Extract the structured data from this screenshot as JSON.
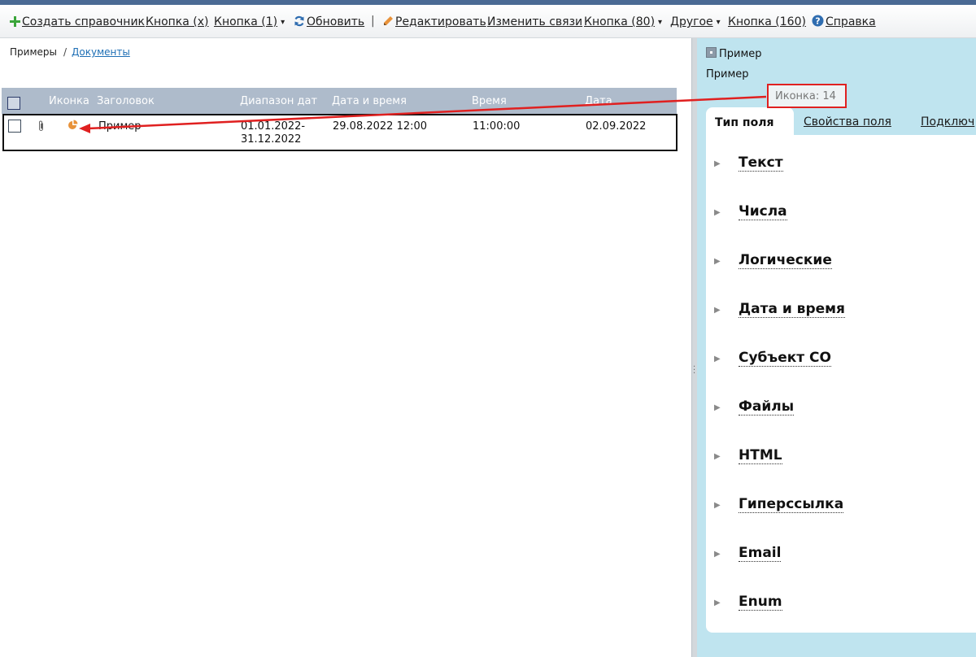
{
  "toolbar": {
    "create_catalog": "Создать справочник",
    "button_x": "Кнопка (x)",
    "button_1": "Кнопка (1)",
    "refresh": "Обновить",
    "separator": "|",
    "edit": "Редактировать",
    "change_links": "Изменить связи",
    "button_80": "Кнопка (80)",
    "other": "Другое",
    "button_160": "Кнопка (160)",
    "help": "Справка",
    "dropdown_glyph": "▾"
  },
  "breadcrumb": {
    "root": "Примеры",
    "separator": "/",
    "current": "Документы"
  },
  "table": {
    "columns": [
      "Иконка",
      "Заголовок",
      "Диапазон дат",
      "Дата и время",
      "Время",
      "Дата"
    ],
    "rows": [
      {
        "title": "Пример",
        "date_range_start": "01.01.2022-",
        "date_range_end": "31.12.2022",
        "datetime": "29.08.2022 12:00",
        "time": "11:00:00",
        "date": "02.09.2022"
      }
    ]
  },
  "detail": {
    "title": "Пример",
    "subtitle": "Пример",
    "callout": "Иконка: 14",
    "tabs": [
      "Тип поля",
      "Свойства поля",
      "Подключ"
    ],
    "categories": [
      "Текст",
      "Числа",
      "Логические",
      "Дата и время",
      "Субъект СО",
      "Файлы",
      "HTML",
      "Гиперссылка",
      "Email",
      "Enum"
    ]
  },
  "colors": {
    "topbar": "#4a6a94",
    "table_header": "#aebbcb",
    "right_panel": "#bfe4ef",
    "callout_border": "#e02020",
    "link": "#1f6fb5",
    "row_icon": "#e8923a"
  }
}
